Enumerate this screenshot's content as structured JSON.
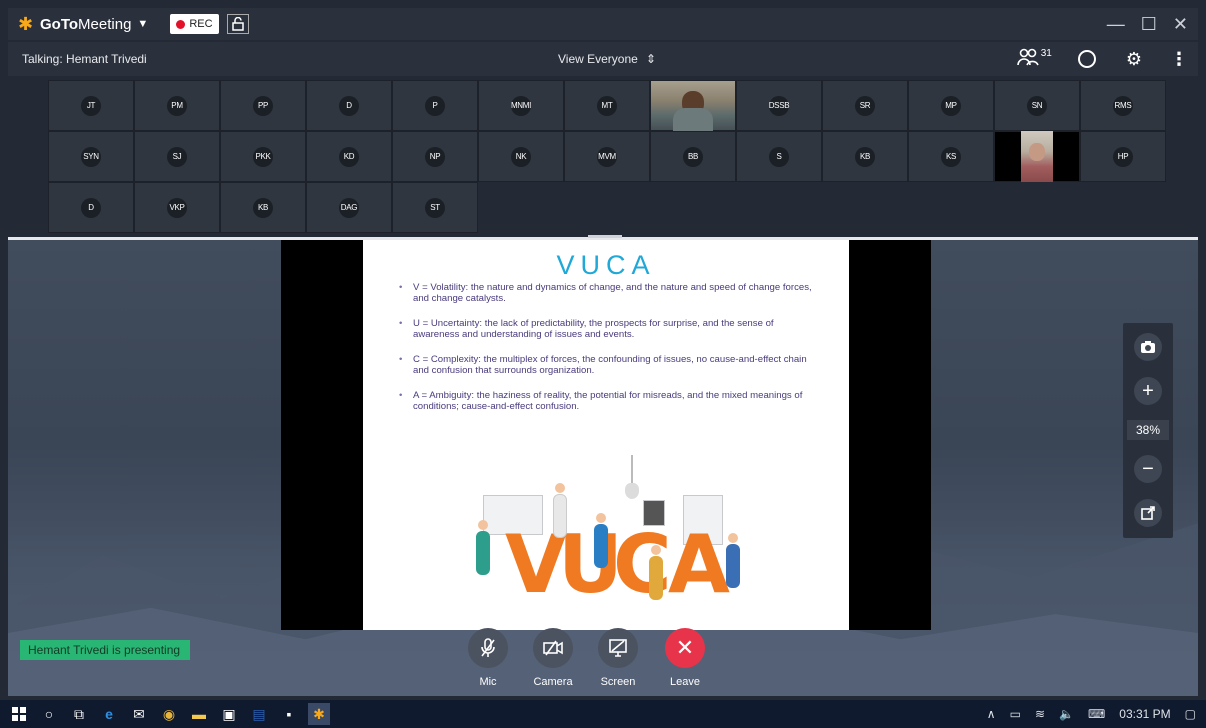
{
  "title_bar": {
    "app_name_bold": "GoTo",
    "app_name_rest": "Meeting",
    "rec_label": "REC",
    "window_controls": [
      "—",
      "☐",
      "✕"
    ]
  },
  "toolbar": {
    "talking": "Talking: Hemant Trivedi",
    "view_label": "View Everyone",
    "participant_count": "31"
  },
  "tiles_row1": [
    "JT",
    "PM",
    "PP",
    "D",
    "P",
    "MNMI",
    "MT",
    "",
    "DSSB",
    "SR",
    "MP",
    "SN",
    "RMS"
  ],
  "tiles_row2": [
    "SYN",
    "SJ",
    "PKK",
    "KD",
    "NP",
    "NK",
    "MVM",
    "BB",
    "S",
    "KB",
    "KS",
    "",
    "HP"
  ],
  "tiles_row3": [
    "D",
    "VKP",
    "KB",
    "DAG",
    "ST"
  ],
  "slide": {
    "title": "VUCA",
    "bullets": [
      "V = Volatility: the nature and dynamics of change, and the nature and speed of change forces, and change catalysts.",
      "U = Uncertainty: the lack of predictability, the prospects for surprise, and the sense of awareness and understanding of issues and events.",
      "C = Complexity: the multiplex of forces, the confounding of issues, no cause-and-effect chain and confusion that surrounds organization.",
      "A = Ambiguity: the haziness of reality, the potential for misreads, and the mixed meanings of conditions; cause-and-effect confusion."
    ],
    "illustration_letters": [
      "V",
      "U",
      "C",
      "A"
    ]
  },
  "zoom": {
    "level": "38%"
  },
  "presenting": "Hemant Trivedi is presenting",
  "controls": {
    "mic": "Mic",
    "camera": "Camera",
    "screen": "Screen",
    "leave": "Leave"
  },
  "taskbar": {
    "time": "03:31 PM"
  },
  "colors": {
    "accent_orange": "#f7a81b",
    "rec_red": "#e3102a",
    "leave_red": "#e8344b",
    "presenting_green": "#29b573",
    "slide_title_blue": "#1fa8d8"
  }
}
